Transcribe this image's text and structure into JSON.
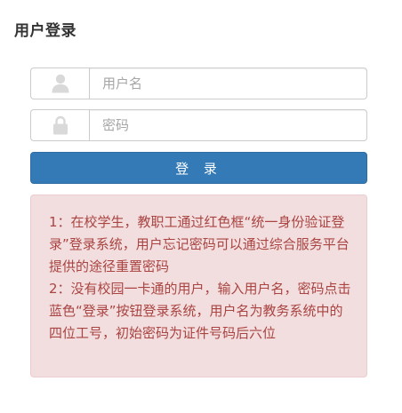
{
  "header": {
    "title": "用户登录"
  },
  "form": {
    "username": {
      "icon": "user-icon",
      "placeholder": "用户名",
      "value": ""
    },
    "password": {
      "icon": "lock-icon",
      "placeholder": "密码",
      "value": ""
    },
    "login_label": "登 录"
  },
  "notice": {
    "line1": "1：在校学生，教职工通过红色框“统一身份验证登录”登录系统，用户忘记密码可以通过综合服务平台提供的途径重置密码",
    "line2": "2：没有校园一卡通的用户，输入用户名，密码点击蓝色“登录”按钮登录系统，用户名为教务系统中的四位工号，初始密码为证件号码后六位"
  },
  "colors": {
    "primary": "#337ab7",
    "notice_bg": "#f2dede",
    "notice_text": "#a94442",
    "icon_gray": "#d9d9d9"
  }
}
